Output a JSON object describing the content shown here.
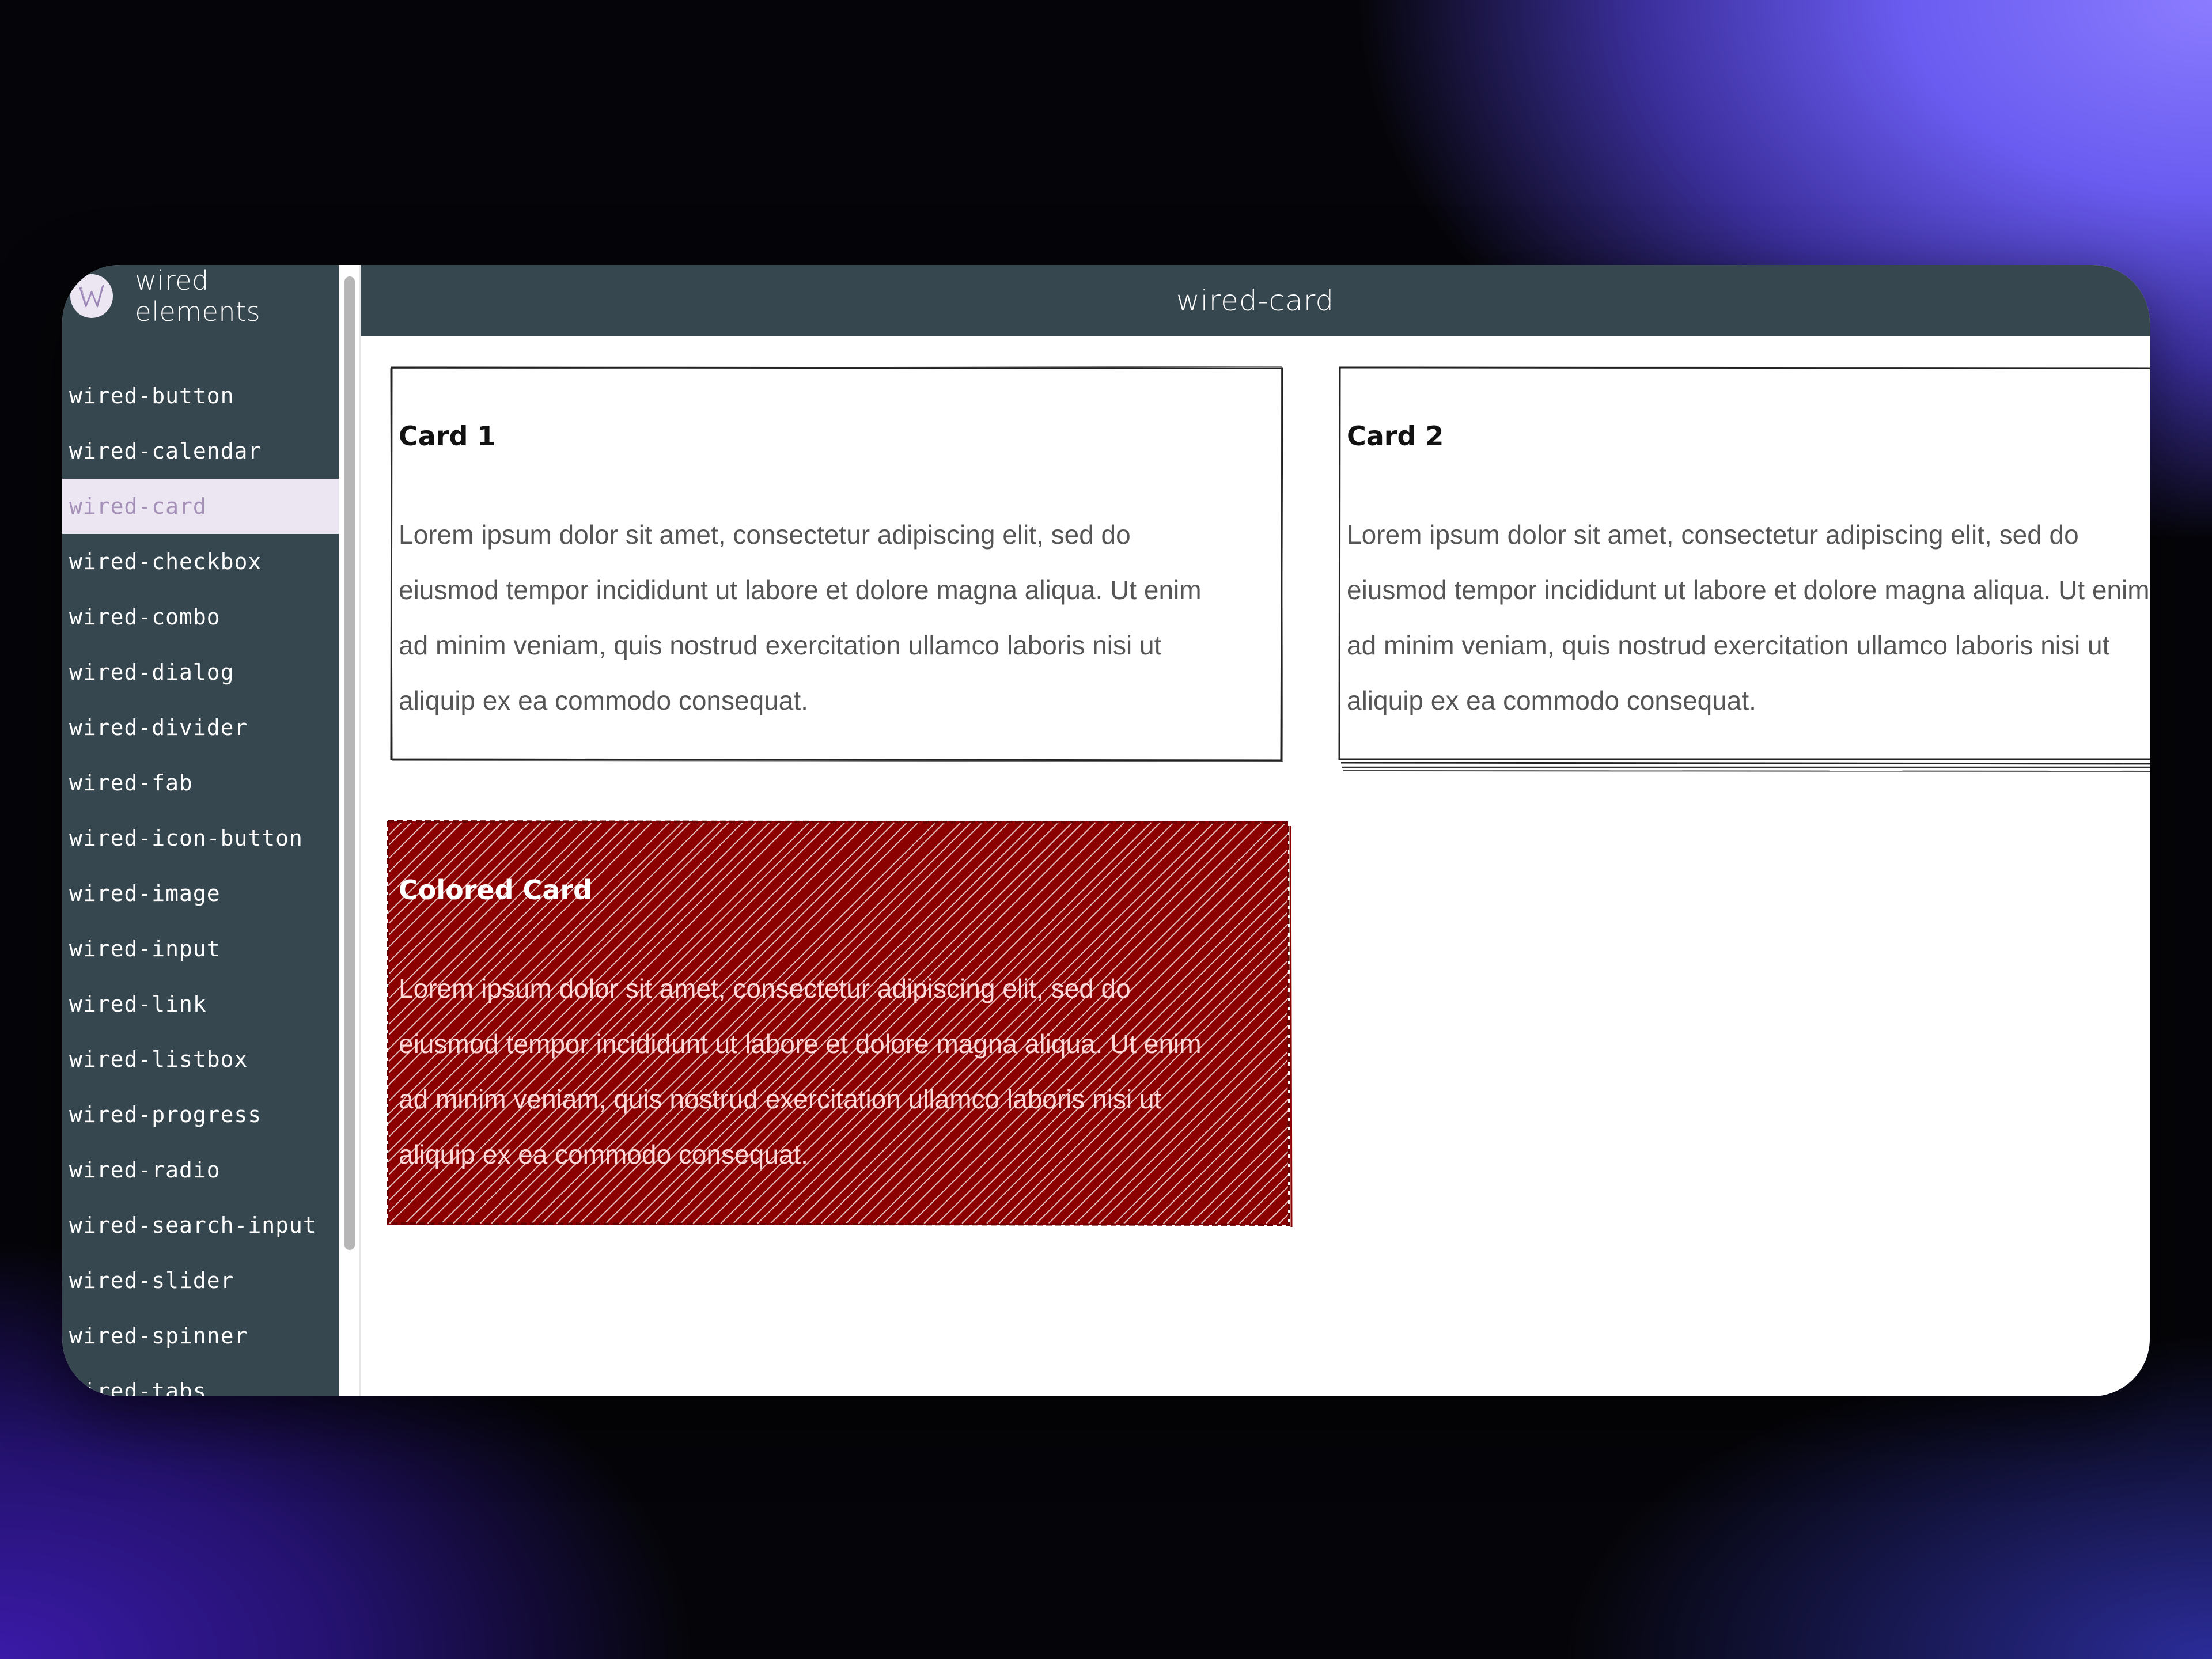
{
  "app": {
    "brand_name": "wired elements",
    "logo_icon": "wired-w-logo-icon"
  },
  "header": {
    "title": "wired-card"
  },
  "sidebar": {
    "active": "wired-card",
    "items": [
      {
        "label": "wired-button"
      },
      {
        "label": "wired-calendar"
      },
      {
        "label": "wired-card"
      },
      {
        "label": "wired-checkbox"
      },
      {
        "label": "wired-combo"
      },
      {
        "label": "wired-dialog"
      },
      {
        "label": "wired-divider"
      },
      {
        "label": "wired-fab"
      },
      {
        "label": "wired-icon-button"
      },
      {
        "label": "wired-image"
      },
      {
        "label": "wired-input"
      },
      {
        "label": "wired-link"
      },
      {
        "label": "wired-listbox"
      },
      {
        "label": "wired-progress"
      },
      {
        "label": "wired-radio"
      },
      {
        "label": "wired-search-input"
      },
      {
        "label": "wired-slider"
      },
      {
        "label": "wired-spinner"
      },
      {
        "label": "wired-tabs"
      }
    ]
  },
  "cards": [
    {
      "title": "Card 1",
      "lines": [
        "Lorem ipsum dolor sit amet, consectetur adipiscing elit, sed do",
        "eiusmod tempor incididunt ut labore et dolore magna aliqua. Ut enim",
        "ad minim veniam, quis nostrud exercitation ullamco laboris nisi ut",
        "aliquip ex ea commodo consequat."
      ]
    },
    {
      "title": "Card 2",
      "lines": [
        "Lorem ipsum dolor sit amet, consectetur adipiscing elit, sed do",
        "eiusmod tempor incididunt ut labore et dolore magna aliqua. Ut enim",
        "ad minim veniam, quis nostrud exercitation ullamco laboris nisi ut",
        "aliquip ex ea commodo consequat."
      ]
    },
    {
      "title": "Colored Card",
      "fill_color": "#8b0000",
      "lines": [
        "Lorem ipsum dolor sit amet, consectetur adipiscing elit, sed do",
        "eiusmod tempor incididunt ut labore et dolore magna aliqua. Ut enim",
        "ad minim veniam, quis nostrud exercitation ullamco laboris nisi ut",
        "aliquip ex ea commodo consequat."
      ]
    }
  ],
  "colors": {
    "sidebar_bg": "#37474f",
    "active_item_bg": "#ece6f3",
    "active_item_text": "#a590b8",
    "colored_card": "#8b0000"
  }
}
